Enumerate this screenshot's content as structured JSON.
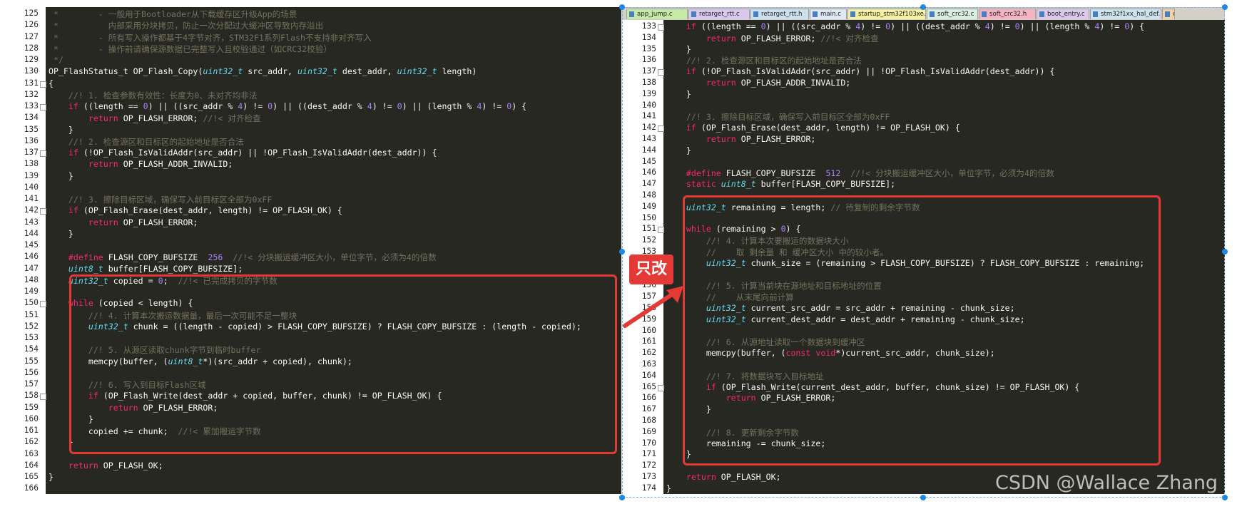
{
  "tabs": [
    "app_jump.c",
    "retarget_rtt.c",
    "retarget_rtt.h",
    "main.c",
    "startup_stm32f103xe.s",
    "soft_crc32.c",
    "soft_crc32.h",
    "boot_entry.c",
    "stm32f1xx_hal_def.h",
    "c"
  ],
  "callout_label": "只改",
  "watermark": "CSDN @Wallace Zhang",
  "left": {
    "line_numbers": [
      "125",
      "126",
      "127",
      "128",
      "129",
      "130",
      "131",
      "132",
      "133",
      "134",
      "135",
      "136",
      "137",
      "138",
      "139",
      "140",
      "141",
      "142",
      "143",
      "144",
      "145",
      "146",
      "147",
      "148",
      "149",
      "150",
      "151",
      "152",
      "153",
      "154",
      "155",
      "156",
      "157",
      "158",
      "159",
      "160",
      "161",
      "162",
      "163",
      "164",
      "165",
      "166"
    ],
    "code": [
      [
        [
          " *        - 一般用于Bootloader从下载缓存区升级App的场景",
          "cm"
        ]
      ],
      [
        [
          " *          内部采用分块拷贝，防止一次分配过大缓冲区导致内存溢出",
          "cm"
        ]
      ],
      [
        [
          " *        - 所有写入操作都基于4字节对齐，STM32F1系列Flash不支持非对齐写入",
          "cm"
        ]
      ],
      [
        [
          " *        - 操作前请确保源数据已完整写入且校验通过（如CRC32校验）",
          "cm"
        ]
      ],
      [
        [
          " */",
          "cm"
        ]
      ],
      [
        [
          "OP_FlashStatus_t OP_Flash_Copy(",
          ""
        ],
        [
          "uint32_t",
          "ty"
        ],
        [
          " src_addr, ",
          ""
        ],
        [
          "uint32_t",
          "ty"
        ],
        [
          " dest_addr, ",
          ""
        ],
        [
          "uint32_t",
          "ty"
        ],
        [
          " length)",
          ""
        ]
      ],
      [
        [
          "{",
          ""
        ]
      ],
      [
        [
          "    //! 1. 检查参数有效性：长度为0、未对齐均非法",
          "cm"
        ]
      ],
      [
        [
          "    ",
          ""
        ],
        [
          "if",
          "kw"
        ],
        [
          " ((length == ",
          ""
        ],
        [
          "0",
          "num"
        ],
        [
          ") || ((src_addr % ",
          ""
        ],
        [
          "4",
          "num"
        ],
        [
          ") != ",
          ""
        ],
        [
          "0",
          "num"
        ],
        [
          ") || ((dest_addr % ",
          ""
        ],
        [
          "4",
          "num"
        ],
        [
          ") != ",
          ""
        ],
        [
          "0",
          "num"
        ],
        [
          ") || (length % ",
          ""
        ],
        [
          "4",
          "num"
        ],
        [
          ") != ",
          ""
        ],
        [
          "0",
          "num"
        ],
        [
          ") {",
          ""
        ]
      ],
      [
        [
          "        ",
          ""
        ],
        [
          "return",
          "kw"
        ],
        [
          " OP_FLASH_ERROR; ",
          ""
        ],
        [
          "//!< 对齐检查",
          "cm"
        ]
      ],
      [
        [
          "    }",
          ""
        ]
      ],
      [
        [
          "    //! 2. 检查源区和目标区的起始地址是否合法",
          "cm"
        ]
      ],
      [
        [
          "    ",
          ""
        ],
        [
          "if",
          "kw"
        ],
        [
          " (!OP_Flash_IsValidAddr(src_addr) || !OP_Flash_IsValidAddr(dest_addr)) {",
          ""
        ]
      ],
      [
        [
          "        ",
          ""
        ],
        [
          "return",
          "kw"
        ],
        [
          " OP_FLASH_ADDR_INVALID;",
          ""
        ]
      ],
      [
        [
          "    }",
          ""
        ]
      ],
      [
        [
          "",
          ""
        ]
      ],
      [
        [
          "    //! 3. 擦除目标区域，确保写入前目标区全部为0xFF",
          "cm"
        ]
      ],
      [
        [
          "    ",
          ""
        ],
        [
          "if",
          "kw"
        ],
        [
          " (OP_Flash_Erase(dest_addr, length) != OP_FLASH_OK) {",
          ""
        ]
      ],
      [
        [
          "        ",
          ""
        ],
        [
          "return",
          "kw"
        ],
        [
          " OP_FLASH_ERROR;",
          ""
        ]
      ],
      [
        [
          "    }",
          ""
        ]
      ],
      [
        [
          "",
          ""
        ]
      ],
      [
        [
          "    ",
          ""
        ],
        [
          "#define",
          "kw"
        ],
        [
          " FLASH_COPY_BUFSIZE  ",
          ""
        ],
        [
          "256",
          "num"
        ],
        [
          "  ",
          ""
        ],
        [
          "//!< 分块搬运缓冲区大小，单位字节，必须为4的倍数",
          "cm"
        ]
      ],
      [
        [
          "    ",
          ""
        ],
        [
          "uint8_t",
          "ty"
        ],
        [
          " buffer[FLASH_COPY_BUFSIZE];",
          ""
        ]
      ],
      [
        [
          "    ",
          ""
        ],
        [
          "uint32_t",
          "ty"
        ],
        [
          " copied = ",
          ""
        ],
        [
          "0",
          "num"
        ],
        [
          ";  ",
          ""
        ],
        [
          "//!< 已完成拷贝的字节数",
          "cm"
        ]
      ],
      [
        [
          "",
          ""
        ]
      ],
      [
        [
          "    ",
          ""
        ],
        [
          "while",
          "kw"
        ],
        [
          " (copied < length) {",
          ""
        ]
      ],
      [
        [
          "        //! 4. 计算本次搬运数据量，最后一次可能不足一整块",
          "cm"
        ]
      ],
      [
        [
          "        ",
          ""
        ],
        [
          "uint32_t",
          "ty"
        ],
        [
          " chunk = ((length - copied) > FLASH_COPY_BUFSIZE) ? FLASH_COPY_BUFSIZE : (length - copied);",
          ""
        ]
      ],
      [
        [
          "",
          ""
        ]
      ],
      [
        [
          "        //! 5. 从源区读取chunk字节到临时buffer",
          "cm"
        ]
      ],
      [
        [
          "        memcpy(buffer, (",
          ""
        ],
        [
          "uint8_t",
          "ty"
        ],
        [
          "*)(src_addr + copied), chunk);",
          ""
        ]
      ],
      [
        [
          "",
          ""
        ]
      ],
      [
        [
          "        //! 6. 写入到目标Flash区域",
          "cm"
        ]
      ],
      [
        [
          "        ",
          ""
        ],
        [
          "if",
          "kw"
        ],
        [
          " (OP_Flash_Write(dest_addr + copied, buffer, chunk) != OP_FLASH_OK) {",
          ""
        ]
      ],
      [
        [
          "            ",
          ""
        ],
        [
          "return",
          "kw"
        ],
        [
          " OP_FLASH_ERROR;",
          ""
        ]
      ],
      [
        [
          "        }",
          ""
        ]
      ],
      [
        [
          "        copied += chunk;  ",
          ""
        ],
        [
          "//!< 累加搬运字节数",
          "cm"
        ]
      ],
      [
        [
          "    }",
          ""
        ]
      ],
      [
        [
          "",
          ""
        ]
      ],
      [
        [
          "    ",
          ""
        ],
        [
          "return",
          "kw"
        ],
        [
          " OP_FLASH_OK;",
          ""
        ]
      ],
      [
        [
          "}",
          ""
        ]
      ],
      [
        [
          "",
          ""
        ]
      ]
    ]
  },
  "right": {
    "line_numbers": [
      "133",
      "134",
      "135",
      "136",
      "137",
      "138",
      "139",
      "140",
      "141",
      "142",
      "143",
      "144",
      "145",
      "146",
      "147",
      "148",
      "149",
      "150",
      "151",
      "152",
      "153",
      "154",
      "155",
      "156",
      "157",
      "158",
      "159",
      "160",
      "161",
      "162",
      "163",
      "164",
      "165",
      "166",
      "167",
      "168",
      "169",
      "170",
      "171",
      "172",
      "173",
      "174"
    ],
    "code": [
      [
        [
          "    ",
          ""
        ],
        [
          "if",
          "kw"
        ],
        [
          " ((length == ",
          ""
        ],
        [
          "0",
          "num"
        ],
        [
          ") || ((src_addr % ",
          ""
        ],
        [
          "4",
          "num"
        ],
        [
          ") != ",
          ""
        ],
        [
          "0",
          "num"
        ],
        [
          ") || ((dest_addr % ",
          ""
        ],
        [
          "4",
          "num"
        ],
        [
          ") != ",
          ""
        ],
        [
          "0",
          "num"
        ],
        [
          ") || (length % ",
          ""
        ],
        [
          "4",
          "num"
        ],
        [
          ") != ",
          ""
        ],
        [
          "0",
          "num"
        ],
        [
          ") {",
          ""
        ]
      ],
      [
        [
          "        ",
          ""
        ],
        [
          "return",
          "kw"
        ],
        [
          " OP_FLASH_ERROR; ",
          ""
        ],
        [
          "//!< 对齐检查",
          "cm"
        ]
      ],
      [
        [
          "    }",
          ""
        ]
      ],
      [
        [
          "    //! 2. 检查源区和目标区的起始地址是否合法",
          "cm"
        ]
      ],
      [
        [
          "    ",
          ""
        ],
        [
          "if",
          "kw"
        ],
        [
          " (!OP_Flash_IsValidAddr(src_addr) || !OP_Flash_IsValidAddr(dest_addr)) {",
          ""
        ]
      ],
      [
        [
          "        ",
          ""
        ],
        [
          "return",
          "kw"
        ],
        [
          " OP_FLASH_ADDR_INVALID;",
          ""
        ]
      ],
      [
        [
          "    }",
          ""
        ]
      ],
      [
        [
          "",
          ""
        ]
      ],
      [
        [
          "    //! 3. 擦除目标区域，确保写入前目标区全部为0xFF",
          "cm"
        ]
      ],
      [
        [
          "    ",
          ""
        ],
        [
          "if",
          "kw"
        ],
        [
          " (OP_Flash_Erase(dest_addr, length) != OP_FLASH_OK) {",
          ""
        ]
      ],
      [
        [
          "        ",
          ""
        ],
        [
          "return",
          "kw"
        ],
        [
          " OP_FLASH_ERROR;",
          ""
        ]
      ],
      [
        [
          "    }",
          ""
        ]
      ],
      [
        [
          "",
          ""
        ]
      ],
      [
        [
          "    ",
          ""
        ],
        [
          "#define",
          "kw"
        ],
        [
          " FLASH_COPY_BUFSIZE  ",
          ""
        ],
        [
          "512",
          "num"
        ],
        [
          "  ",
          ""
        ],
        [
          "//!< 分块搬运缓冲区大小，单位字节，必须为4的倍数",
          "cm"
        ]
      ],
      [
        [
          "    ",
          ""
        ],
        [
          "static",
          "kw"
        ],
        [
          " ",
          ""
        ],
        [
          "uint8_t",
          "ty"
        ],
        [
          " buffer[FLASH_COPY_BUFSIZE];",
          ""
        ]
      ],
      [
        [
          "",
          ""
        ]
      ],
      [
        [
          "    ",
          ""
        ],
        [
          "uint32_t",
          "ty"
        ],
        [
          " remaining = length; ",
          ""
        ],
        [
          "// 待复制的剩余字节数",
          "cm"
        ]
      ],
      [
        [
          "",
          ""
        ]
      ],
      [
        [
          "    ",
          ""
        ],
        [
          "while",
          "kw"
        ],
        [
          " (remaining > ",
          ""
        ],
        [
          "0",
          "num"
        ],
        [
          ") {",
          ""
        ]
      ],
      [
        [
          "        //! 4. 计算本次要搬运的数据块大小",
          "cm"
        ]
      ],
      [
        [
          "        //    取 剩余量 和 缓冲区大小 中的较小者。",
          "cm"
        ]
      ],
      [
        [
          "        ",
          ""
        ],
        [
          "uint32_t",
          "ty"
        ],
        [
          " chunk_size = (remaining > FLASH_COPY_BUFSIZE) ? FLASH_COPY_BUFSIZE : remaining;",
          ""
        ]
      ],
      [
        [
          "",
          ""
        ]
      ],
      [
        [
          "        //! 5. 计算当前块在源地址和目标地址的位置",
          "cm"
        ]
      ],
      [
        [
          "        //    从末尾向前计算",
          "cm"
        ]
      ],
      [
        [
          "        ",
          ""
        ],
        [
          "uint32_t",
          "ty"
        ],
        [
          " current_src_addr = src_addr + remaining - chunk_size;",
          ""
        ]
      ],
      [
        [
          "        ",
          ""
        ],
        [
          "uint32_t",
          "ty"
        ],
        [
          " current_dest_addr = dest_addr + remaining - chunk_size;",
          ""
        ]
      ],
      [
        [
          "",
          ""
        ]
      ],
      [
        [
          "        //! 6. 从源地址读取一个数据块到缓冲区",
          "cm"
        ]
      ],
      [
        [
          "        memcpy(buffer, (",
          ""
        ],
        [
          "const",
          "kw"
        ],
        [
          " ",
          ""
        ],
        [
          "void",
          "kw"
        ],
        [
          "*)current_src_addr, chunk_size);",
          ""
        ]
      ],
      [
        [
          "",
          ""
        ]
      ],
      [
        [
          "        //! 7. 将数据块写入目标地址",
          "cm"
        ]
      ],
      [
        [
          "        ",
          ""
        ],
        [
          "if",
          "kw"
        ],
        [
          " (OP_Flash_Write(current_dest_addr, buffer, chunk_size) != OP_FLASH_OK) {",
          ""
        ]
      ],
      [
        [
          "            ",
          ""
        ],
        [
          "return",
          "kw"
        ],
        [
          " OP_FLASH_ERROR;",
          ""
        ]
      ],
      [
        [
          "        }",
          ""
        ]
      ],
      [
        [
          "",
          ""
        ]
      ],
      [
        [
          "        //! 8. 更新剩余字节数",
          "cm"
        ]
      ],
      [
        [
          "        remaining -= chunk_size;",
          ""
        ]
      ],
      [
        [
          "    }",
          ""
        ]
      ],
      [
        [
          "",
          ""
        ]
      ],
      [
        [
          "    ",
          ""
        ],
        [
          "return",
          "kw"
        ],
        [
          " OP_FLASH_OK;",
          ""
        ]
      ],
      [
        [
          "}",
          ""
        ]
      ]
    ]
  }
}
